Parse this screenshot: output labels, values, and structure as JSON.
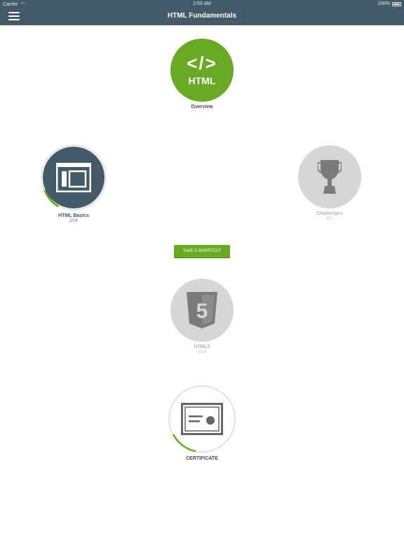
{
  "status_bar": {
    "carrier": "Carrier",
    "time": "3:53 AM",
    "battery": "100%"
  },
  "header": {
    "title": "HTML Fundamentals"
  },
  "nodes": {
    "overview": {
      "label": "Overview",
      "glyph": "</>",
      "text": "HTML"
    },
    "html_basics": {
      "label": "HTML Basics",
      "progress": "2/14"
    },
    "challenges": {
      "label": "Challenges",
      "progress": "0/1"
    },
    "html5": {
      "label": "HTML5",
      "progress": "0/19",
      "glyph": "5"
    },
    "certificate": {
      "label": "CERTIFICATE"
    }
  },
  "shortcut_button": {
    "label": "TAKE A SHORTCUT"
  },
  "colors": {
    "header_bg": "#445a66",
    "accent_green": "#6aa924",
    "dark_node": "#445a66",
    "locked_node": "#d6d6d6",
    "locked_icon": "#7b7b7b"
  }
}
